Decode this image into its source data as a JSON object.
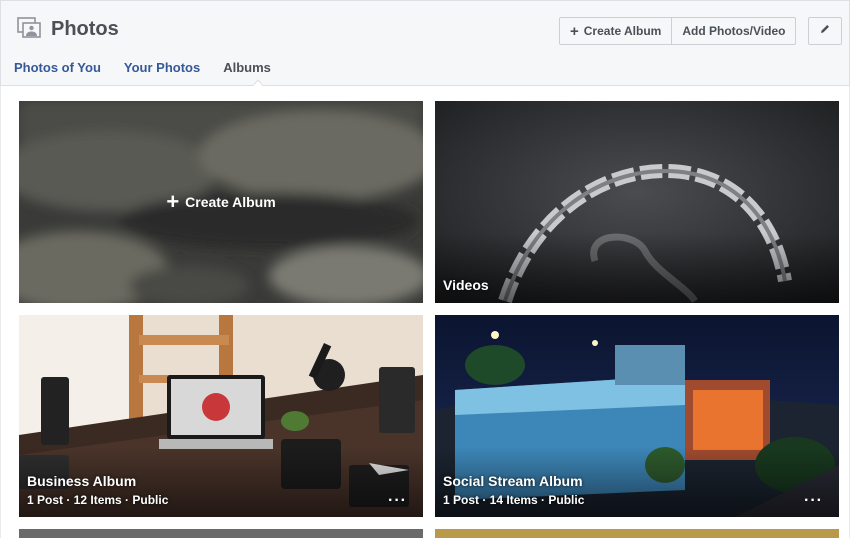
{
  "header": {
    "title": "Photos",
    "create_album_label": "Create Album",
    "add_photos_label": "Add Photos/Video"
  },
  "tabs": [
    {
      "label": "Photos of You"
    },
    {
      "label": "Your Photos"
    },
    {
      "label": "Albums"
    }
  ],
  "active_tab": "Albums",
  "albums": [
    {
      "title": "Create Album",
      "type": "create"
    },
    {
      "title": "Videos",
      "type": "album"
    },
    {
      "title": "Business Album",
      "meta": "1 Post · 12 Items · Public"
    },
    {
      "title": "Social Stream Album",
      "meta": "1 Post · 14 Items · Public"
    }
  ],
  "colors": {
    "link": "#365899",
    "header_bg": "#f6f7f9",
    "page_bg": "#e9ebee"
  }
}
